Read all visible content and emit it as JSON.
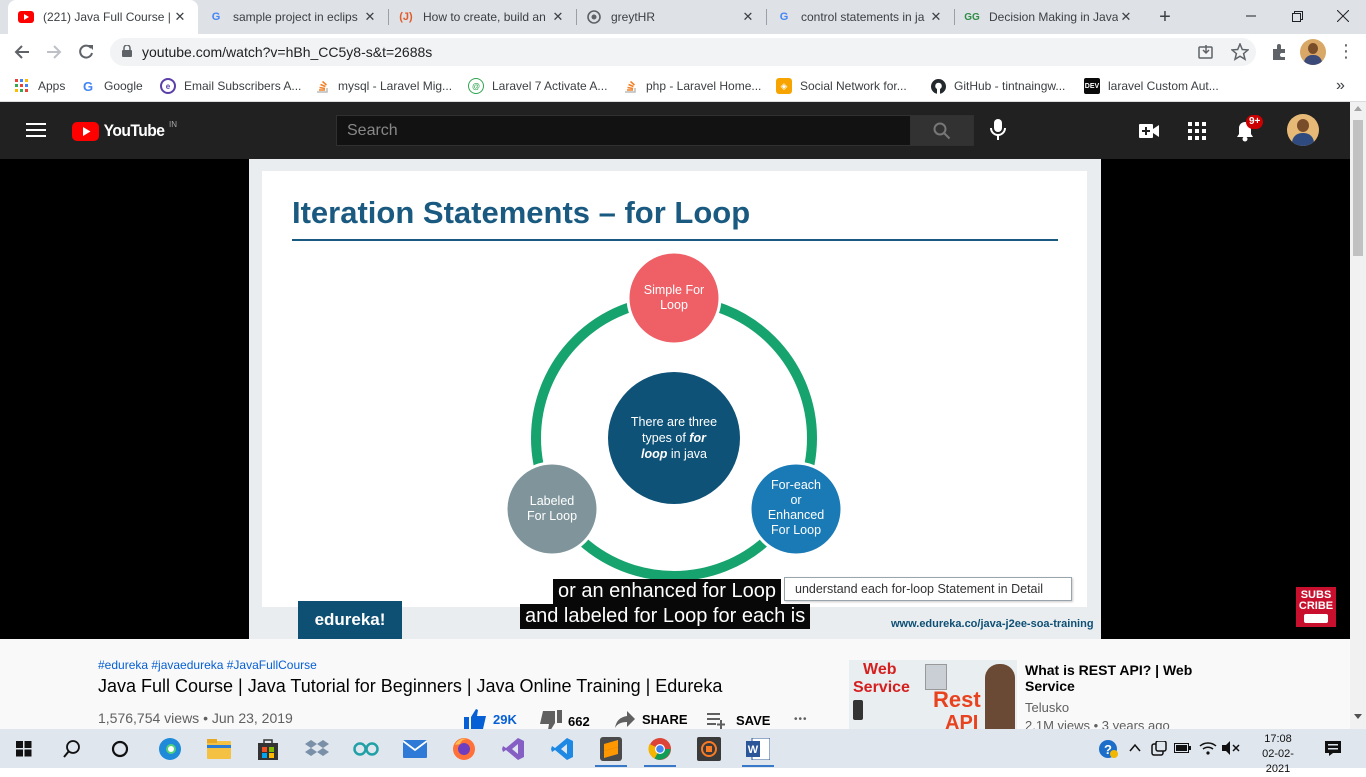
{
  "browser": {
    "tabs": [
      {
        "title": "(221) Java Full Course |",
        "favicon": "youtube-icon",
        "active": true
      },
      {
        "title": "sample project in eclips",
        "favicon": "google-icon",
        "active": false
      },
      {
        "title": "How to create, build an",
        "favicon": "javatpoint-icon",
        "active": false
      },
      {
        "title": "greytHR",
        "favicon": "globe-icon",
        "active": false
      },
      {
        "title": "control statements in ja",
        "favicon": "google-icon",
        "active": false
      },
      {
        "title": "Decision Making in Java",
        "favicon": "geeksforgeeks-icon",
        "active": false
      }
    ],
    "new_tab": "+",
    "url": "youtube.com/watch?v=hBh_CC5y8-s&t=2688s",
    "bookmarks": [
      {
        "label": "Apps",
        "icon": "apps-grid-icon"
      },
      {
        "label": "Google",
        "icon": "google-icon"
      },
      {
        "label": "Email Subscribers A...",
        "icon": "plugin-icon"
      },
      {
        "label": "mysql - Laravel Mig...",
        "icon": "stackoverflow-icon"
      },
      {
        "label": "Laravel 7 Activate A...",
        "icon": "site-icon"
      },
      {
        "label": "php - Laravel Home...",
        "icon": "stackoverflow-icon"
      },
      {
        "label": "Social Network for...",
        "icon": "site-icon"
      },
      {
        "label": "GitHub - tintnaingw...",
        "icon": "github-icon"
      },
      {
        "label": "laravel Custom Aut...",
        "icon": "dev-icon"
      }
    ],
    "more_bookmarks": "»"
  },
  "youtube": {
    "logo_text": "YouTube",
    "country": "IN",
    "search_placeholder": "Search",
    "notifications_badge": "9+",
    "video": {
      "slide_title": "Iteration Statements – for Loop",
      "circles": {
        "top": [
          "Simple For",
          "Loop"
        ],
        "center": [
          "There are three",
          "types of",
          "for",
          "loop",
          "in java"
        ],
        "right": [
          "For-each",
          "or",
          "Enhanced",
          "For Loop"
        ],
        "left": [
          "Labeled",
          "For Loop"
        ]
      },
      "box_text": "understand each for-loop Statement in Detail",
      "brand": "edureka!",
      "url_footer": "www.edureka.co/java-j2ee-soa-training",
      "subscribe_lines": [
        "SUBS",
        "CRIBE"
      ],
      "captions": [
        "or an enhanced for Loop",
        "and labeled for Loop for each is"
      ]
    },
    "hashtags": "#edureka #javaedureka #JavaFullCourse",
    "title": "Java Full Course | Java Tutorial for Beginners | Java Online Training | Edureka",
    "views_date": "1,576,754 views • Jun 23, 2019",
    "likes": "29K",
    "dislikes": "662",
    "share": "SHARE",
    "save": "SAVE",
    "more": "•••",
    "recommended": {
      "title": "What is REST API? | Web Service",
      "channel": "Telusko",
      "meta": "2.1M views • 3 years ago",
      "thumb_text_1": "Web",
      "thumb_text_2": "Service",
      "thumb_text_3": "Rest",
      "thumb_text_4": "API"
    }
  },
  "taskbar": {
    "time": "17:08",
    "date": "02-02-2021"
  },
  "colors": {
    "circle_top": "#ee5f66",
    "circle_center": "#0e5278",
    "circle_right": "#1a7ab6",
    "circle_left": "#7f959b",
    "ring": "#16a36e",
    "youtube_red": "#ff0000"
  }
}
